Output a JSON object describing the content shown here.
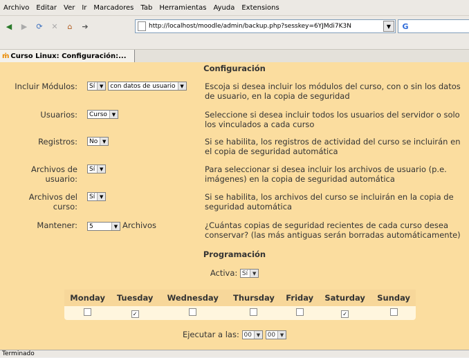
{
  "menu": [
    "Archivo",
    "Editar",
    "Ver",
    "Ir",
    "Marcadores",
    "Tab",
    "Herramientas",
    "Ayuda",
    "Extensions"
  ],
  "url": "http://localhost/moodle/admin/backup.php?sesskey=6YJMdi7K3N",
  "tab_title": "Curso Linux: Configuración:...",
  "status": "Terminado",
  "config_heading": "Configuración",
  "rows": [
    {
      "label": "Incluir Módulos:",
      "select": "Sí",
      "select2": "con datos de usuario",
      "desc": "Escoja si desea incluir los módulos del curso, con o sin los datos de usuario, en la copia de seguridad"
    },
    {
      "label": "Usuarios:",
      "select": "Curso",
      "desc": "Seleccione si desea incluir todos los usuarios del servidor o solo los vinculados a cada curso"
    },
    {
      "label": "Registros:",
      "select": "No",
      "desc": "Si se habilita, los registros de actividad del curso se incluirán en el copia de seguridad automática"
    },
    {
      "label": "Archivos de usuario:",
      "select": "Sí",
      "desc": "Para seleccionar si desea incluir los archivos de usuario (p.e. imágenes) en la copia de seguridad automática"
    },
    {
      "label": "Archivos del curso:",
      "select": "Sí",
      "desc": "Si se habilita, los archivos del curso se incluirán en la copia de seguridad automática"
    },
    {
      "label": "Mantener:",
      "select": "5",
      "suffix": "Archivos",
      "desc": "¿Cuántas copias de seguridad recientes de cada curso desea conservar? (las más antiguas serán borradas automáticamente)"
    }
  ],
  "sched_heading": "Programación",
  "active_label": "Activa:",
  "active_value": "Sí",
  "days": [
    "Monday",
    "Tuesday",
    "Wednesday",
    "Thursday",
    "Friday",
    "Saturday",
    "Sunday"
  ],
  "days_checked": [
    false,
    true,
    false,
    false,
    false,
    true,
    false
  ],
  "run_label": "Ejecutar a las:",
  "hour": "00",
  "minute": "00"
}
